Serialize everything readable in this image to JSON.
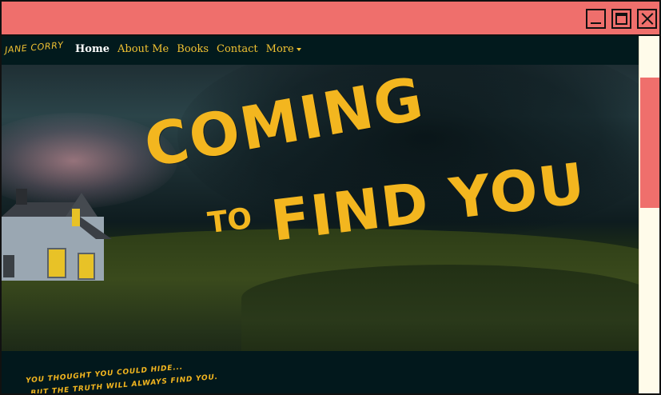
{
  "site": {
    "logo_text": "JANE CORRY"
  },
  "nav": {
    "items": [
      {
        "label": "Home"
      },
      {
        "label": "About Me"
      },
      {
        "label": "Books"
      },
      {
        "label": "Contact"
      },
      {
        "label": "More"
      }
    ]
  },
  "hero": {
    "title_line1": "COMING",
    "title_line2_small": "TO",
    "title_line2_big": "FIND YOU"
  },
  "tagline": {
    "line1": "YOU THOUGHT YOU COULD HIDE...",
    "line2": "BUT THE TRUTH WILL ALWAYS FIND YOU."
  },
  "colors": {
    "titlebar": "#ef6f6c",
    "accent_yellow": "#f3b61f",
    "nav_bg": "#021a1d",
    "scrollbar_track": "#fffbea"
  },
  "icons": {
    "minimize": "minimize-icon",
    "maximize": "maximize-icon",
    "close": "close-icon",
    "dropdown": "caret-down-icon"
  }
}
